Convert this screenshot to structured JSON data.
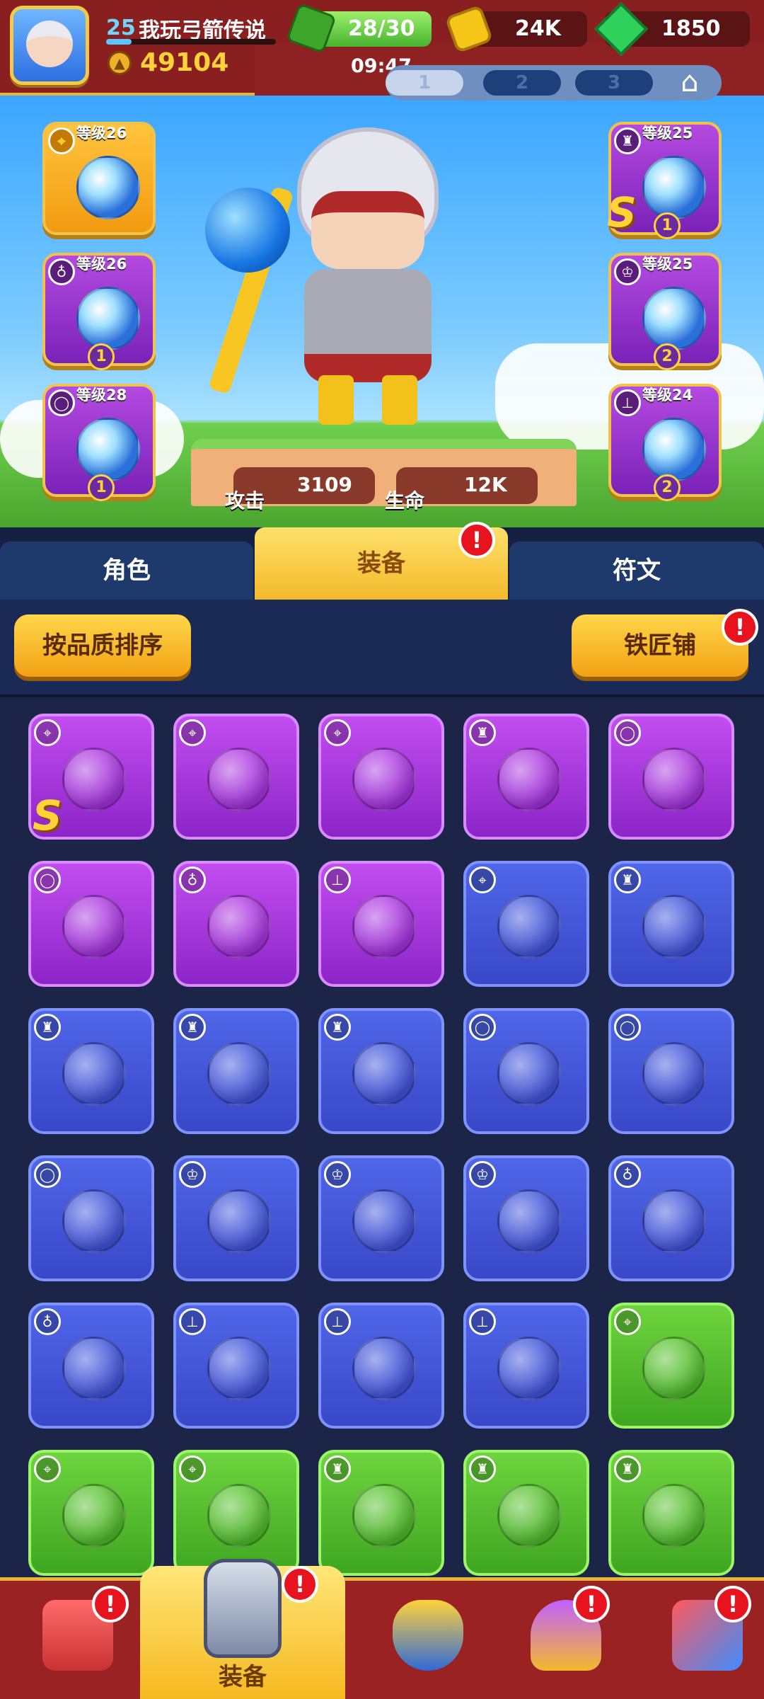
{
  "header": {
    "player_level": "25",
    "player_name": "我玩弓箭传说",
    "power": "49104",
    "energy": "28/30",
    "coins": "24K",
    "gems": "1850",
    "clock": "09:47",
    "loadout_tabs": [
      "1",
      "2",
      "3"
    ]
  },
  "hero": {
    "equipped_left": [
      {
        "level": "等级26",
        "category": "weapon",
        "rarity": "gold",
        "item": "staff-icon"
      },
      {
        "level": "等级26",
        "category": "necklace",
        "rarity": "purple",
        "item": "octopus-necklace-icon",
        "stars": "1"
      },
      {
        "level": "等级28",
        "category": "ring",
        "rarity": "purple",
        "item": "ring-icon",
        "stars": "1"
      }
    ],
    "equipped_right": [
      {
        "level": "等级25",
        "category": "armor",
        "rarity": "purple",
        "item": "armor-icon",
        "stars": "1",
        "badge": "S"
      },
      {
        "level": "等级25",
        "category": "helmet",
        "rarity": "purple",
        "item": "crown-icon",
        "stars": "2"
      },
      {
        "level": "等级24",
        "category": "boots",
        "rarity": "purple",
        "item": "boots-icon",
        "stars": "2"
      }
    ],
    "attack_label": "攻击",
    "attack_value": "3109",
    "hp_label": "生命",
    "hp_value": "12K"
  },
  "tabs": [
    {
      "label": "角色",
      "active": false
    },
    {
      "label": "装备",
      "active": true,
      "alert": "!"
    },
    {
      "label": "符文",
      "active": false
    }
  ],
  "toolbar": {
    "sort_label": "按品质排序",
    "smith_label": "铁匠铺",
    "smith_alert": "!"
  },
  "inventory": [
    {
      "rarity": "purple",
      "category": "weapon",
      "item": "spear-icon",
      "badge": "S"
    },
    {
      "rarity": "purple",
      "category": "weapon",
      "item": "bow-icon"
    },
    {
      "rarity": "purple",
      "category": "weapon",
      "item": "staff-icon"
    },
    {
      "rarity": "purple",
      "category": "armor",
      "item": "cloak-icon"
    },
    {
      "rarity": "purple",
      "category": "ring",
      "item": "ring-icon"
    },
    {
      "rarity": "purple",
      "category": "ring",
      "item": "jade-ring-icon"
    },
    {
      "rarity": "purple",
      "category": "necklace",
      "item": "amulet-icon"
    },
    {
      "rarity": "purple",
      "category": "boots",
      "item": "boots-icon"
    },
    {
      "rarity": "blue",
      "category": "weapon",
      "item": "claw-icon"
    },
    {
      "rarity": "blue",
      "category": "armor",
      "item": "armor-icon"
    },
    {
      "rarity": "blue",
      "category": "armor",
      "item": "armor-icon"
    },
    {
      "rarity": "blue",
      "category": "armor",
      "item": "gold-armor-icon"
    },
    {
      "rarity": "blue",
      "category": "armor",
      "item": "gold-armor-icon"
    },
    {
      "rarity": "blue",
      "category": "ring",
      "item": "ring-icon"
    },
    {
      "rarity": "blue",
      "category": "ring",
      "item": "ring-icon"
    },
    {
      "rarity": "blue",
      "category": "ring",
      "item": "orange-ring-icon"
    },
    {
      "rarity": "blue",
      "category": "helmet",
      "item": "mask-icon"
    },
    {
      "rarity": "blue",
      "category": "helmet",
      "item": "mask-icon"
    },
    {
      "rarity": "blue",
      "category": "helmet",
      "item": "knight-helmet-icon"
    },
    {
      "rarity": "blue",
      "category": "necklace",
      "item": "octopus-necklace-icon"
    },
    {
      "rarity": "blue",
      "category": "necklace",
      "item": "octopus-necklace-icon"
    },
    {
      "rarity": "blue",
      "category": "boots",
      "item": "boots-icon"
    },
    {
      "rarity": "blue",
      "category": "boots",
      "item": "boots-icon"
    },
    {
      "rarity": "blue",
      "category": "boots",
      "item": "jade-boots-icon"
    },
    {
      "rarity": "green",
      "category": "weapon",
      "item": "bow-icon"
    },
    {
      "rarity": "green",
      "category": "weapon",
      "item": "bow-icon"
    },
    {
      "rarity": "green",
      "category": "weapon",
      "item": "staff-icon"
    },
    {
      "rarity": "green",
      "category": "armor",
      "item": "armor-icon"
    },
    {
      "rarity": "green",
      "category": "armor",
      "item": "armor-icon"
    },
    {
      "rarity": "green",
      "category": "armor",
      "item": "gold-armor-icon"
    }
  ],
  "nav": {
    "shop_alert": "!",
    "equip_label": "装备",
    "equip_alert": "!",
    "trophy_alert": "!",
    "events_alert": "!"
  },
  "colors": {
    "header": "#8a1f1f",
    "gold_trim": "#e7b43a",
    "purple": "#a83ddc",
    "blue": "#4458d8",
    "green": "#55bd30",
    "alert": "#e7131f"
  }
}
